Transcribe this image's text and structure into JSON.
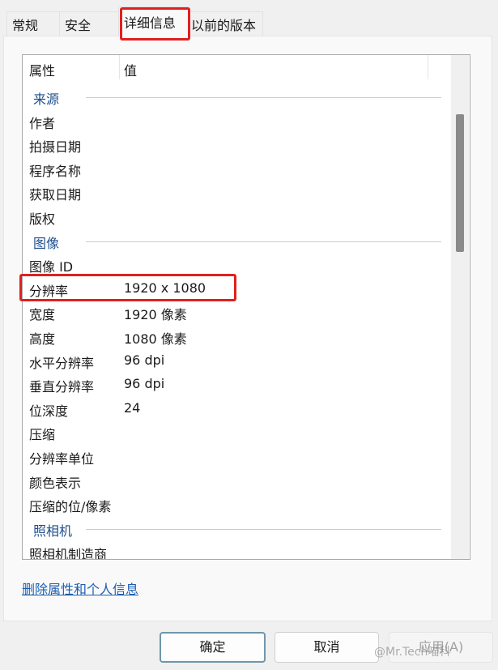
{
  "tabs": [
    {
      "label": "常规"
    },
    {
      "label": "安全"
    },
    {
      "label": "详细信息",
      "active": true
    },
    {
      "label": "以前的版本"
    }
  ],
  "list": {
    "headers": {
      "property": "属性",
      "value": "值"
    },
    "rows": [
      {
        "group": true,
        "k": "来源"
      },
      {
        "k": "作者",
        "v": ""
      },
      {
        "k": "拍摄日期",
        "v": ""
      },
      {
        "k": "程序名称",
        "v": ""
      },
      {
        "k": "获取日期",
        "v": ""
      },
      {
        "k": "版权",
        "v": ""
      },
      {
        "group": true,
        "k": "图像"
      },
      {
        "k": "图像 ID",
        "v": ""
      },
      {
        "k": "分辨率",
        "v": "1920 x 1080",
        "highlight": true
      },
      {
        "k": "宽度",
        "v": "1920 像素"
      },
      {
        "k": "高度",
        "v": "1080 像素"
      },
      {
        "k": "水平分辨率",
        "v": "96 dpi"
      },
      {
        "k": "垂直分辨率",
        "v": "96 dpi"
      },
      {
        "k": "位深度",
        "v": "24"
      },
      {
        "k": "压缩",
        "v": ""
      },
      {
        "k": "分辨率单位",
        "v": ""
      },
      {
        "k": "颜色表示",
        "v": ""
      },
      {
        "k": "压缩的位/像素",
        "v": ""
      },
      {
        "group": true,
        "k": "照相机"
      },
      {
        "k": "照相机制造商",
        "v": ""
      }
    ]
  },
  "remove_link": "删除属性和个人信息",
  "buttons": {
    "ok": "确定",
    "cancel": "取消",
    "apply": "应用(A)"
  },
  "watermark": "@Mr.Tech喵科",
  "colors": {
    "highlight": "#e02020",
    "group_text": "#1e4e8c",
    "link": "#1a5fb4"
  }
}
